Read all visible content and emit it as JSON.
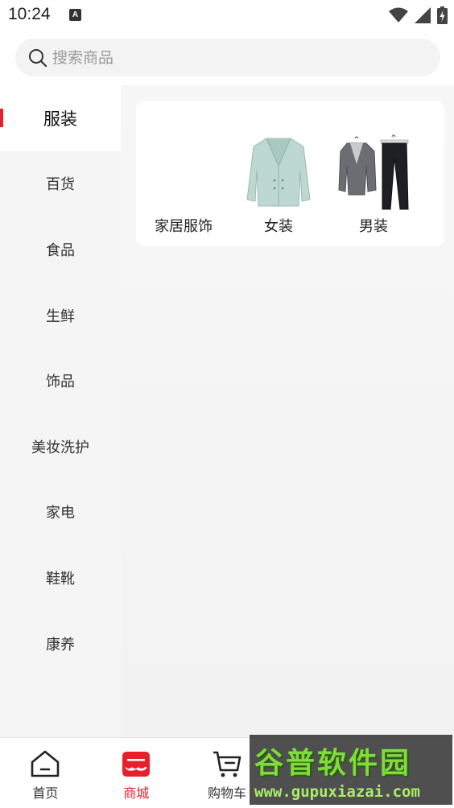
{
  "status": {
    "time": "10:24",
    "notif_icon_letter": "A",
    "icons": [
      "wifi-icon",
      "signal-icon",
      "battery-icon"
    ]
  },
  "search": {
    "placeholder": "搜索商品"
  },
  "sidebar": {
    "accent_color": "#e8202a",
    "items": [
      {
        "label": "服装",
        "active": true
      },
      {
        "label": "百货",
        "active": false
      },
      {
        "label": "食品",
        "active": false
      },
      {
        "label": "生鲜",
        "active": false
      },
      {
        "label": "饰品",
        "active": false
      },
      {
        "label": "美妆洗护",
        "active": false
      },
      {
        "label": "家电",
        "active": false
      },
      {
        "label": "鞋靴",
        "active": false
      },
      {
        "label": "康养",
        "active": false
      }
    ]
  },
  "subcategories": [
    {
      "label": "家居服饰",
      "image": "none"
    },
    {
      "label": "女装",
      "image": "mint-blazer-image"
    },
    {
      "label": "男装",
      "image": "gray-suit-image"
    }
  ],
  "tabbar": {
    "active_color": "#e8202a",
    "items": [
      {
        "label": "首页",
        "icon": "home-icon",
        "active": false
      },
      {
        "label": "商城",
        "icon": "shop-icon",
        "active": true
      },
      {
        "label": "购物车",
        "icon": "cart-icon",
        "active": false
      },
      {
        "label": "",
        "icon": "hidden-icon",
        "active": false
      },
      {
        "label": "",
        "icon": "hidden-icon",
        "active": false
      }
    ]
  },
  "watermark": {
    "title": "谷普软件园",
    "url": "www.gupuxiazai.com"
  }
}
